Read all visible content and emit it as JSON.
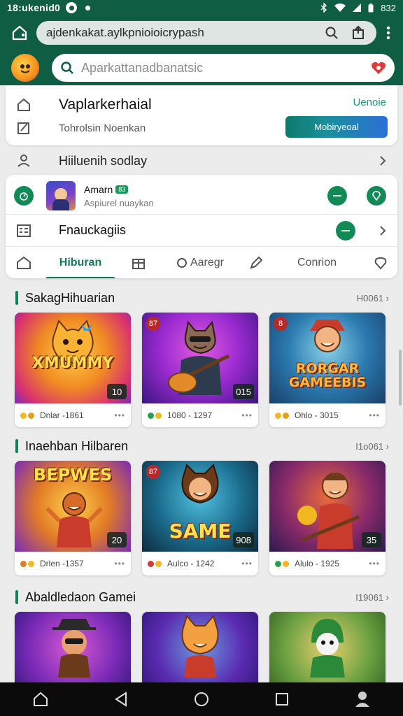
{
  "status": {
    "time": "18:ukenid0",
    "battery": "832"
  },
  "browser": {
    "url": "ajdenkakat.aylkpnioioicrypash"
  },
  "search": {
    "placeholder": "Aparkattanadbanatsic"
  },
  "header_card": {
    "title": "Vaplarkerhaial",
    "subtitle": "Tohrolsin Noenkan",
    "link": "Uenoie",
    "button": "Mobiryeoal"
  },
  "hiburan_row": {
    "label": "Hiiluenih sodlay"
  },
  "user": {
    "name": "Amarn",
    "badge": "83",
    "sub": "Aspiurel nuaykan"
  },
  "feature": {
    "label": "Fnauckagiis"
  },
  "tabs": [
    "Hiburan",
    "Aaregr",
    "Conrion"
  ],
  "sections": [
    {
      "title": "SakagHihuarian",
      "more": "H0061",
      "cards": [
        {
          "title": "XMUMMY",
          "badge": "10",
          "tl": "",
          "meta": "Dnlar -1861",
          "c1": "#f2b81f",
          "c2": "#e0a21a"
        },
        {
          "title": "",
          "badge": "015",
          "tl": "87",
          "meta": "1080 - 1297",
          "c1": "#26a04a",
          "c2": "#f2b81f"
        },
        {
          "title": "RORGAR GAMEEBIS",
          "badge": "",
          "tl": "8",
          "meta": "Ohlo - 3015",
          "c1": "#f2b81f",
          "c2": "#e0a21a"
        }
      ]
    },
    {
      "title": "Inaehban Hilbaren",
      "more": "I1o061",
      "cards": [
        {
          "title": "BEPWES",
          "badge": "20",
          "tl": "",
          "meta": "Drlen -1357",
          "c1": "#e27b26",
          "c2": "#f2b81f"
        },
        {
          "title": "SAME",
          "badge": "908",
          "tl": "87",
          "meta": "Aulco - 1242",
          "c1": "#d43a3a",
          "c2": "#f2b81f"
        },
        {
          "title": "",
          "badge": "35",
          "tl": "",
          "meta": "Alulo - 1925",
          "c1": "#26a04a",
          "c2": "#f2b81f"
        }
      ]
    },
    {
      "title": "Abaldledaon Gamei",
      "more": "I19061",
      "cards": [
        {
          "title": "",
          "badge": "",
          "tl": "",
          "meta": "",
          "c1": "#f2b81f",
          "c2": "#e0a21a"
        },
        {
          "title": "",
          "badge": "",
          "tl": "",
          "meta": "",
          "c1": "#f2b81f",
          "c2": "#e0a21a"
        },
        {
          "title": "",
          "badge": "",
          "tl": "",
          "meta": "",
          "c1": "#f2b81f",
          "c2": "#e0a21a"
        }
      ]
    }
  ],
  "colors": {
    "brand": "#0f5e44",
    "accent": "#127a5a",
    "button_start": "#0f7a6a",
    "button_end": "#2d6fd8"
  }
}
